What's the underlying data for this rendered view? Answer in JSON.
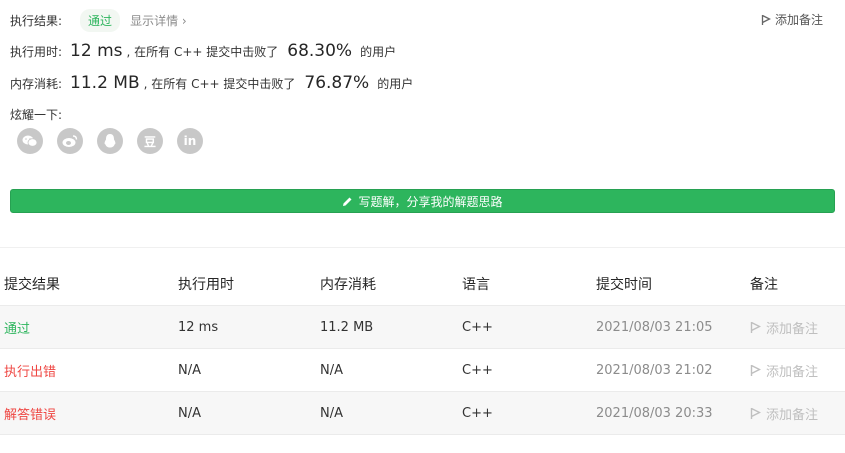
{
  "result": {
    "label": "执行结果:",
    "status": "通过",
    "details_link": "显示详情 ›",
    "add_note": "添加备注"
  },
  "runtime": {
    "label": "执行用时:",
    "value": "12 ms",
    "mid": ", 在所有 C++ 提交中击败了",
    "percent": "68.30%",
    "suffix": "的用户"
  },
  "memory": {
    "label": "内存消耗:",
    "value": "11.2 MB",
    "mid": ", 在所有 C++ 提交中击败了",
    "percent": "76.87%",
    "suffix": "的用户"
  },
  "share": {
    "label": "炫耀一下:",
    "icons": [
      "wechat-icon",
      "weibo-icon",
      "qq-icon",
      "douban-icon",
      "linkedin-icon"
    ],
    "douban_glyph": "豆",
    "linkedin_glyph": "in"
  },
  "write_solution_label": "写题解，分享我的解题思路",
  "table": {
    "headers": [
      "提交结果",
      "执行用时",
      "内存消耗",
      "语言",
      "提交时间",
      "备注"
    ],
    "rows": [
      {
        "status": "通过",
        "status_type": "pass",
        "runtime": "12 ms",
        "memory": "11.2 MB",
        "lang": "C++",
        "time": "2021/08/03 21:05",
        "note": "添加备注"
      },
      {
        "status": "执行出错",
        "status_type": "error",
        "runtime": "N/A",
        "memory": "N/A",
        "lang": "C++",
        "time": "2021/08/03 21:02",
        "note": "添加备注"
      },
      {
        "status": "解答错误",
        "status_type": "error",
        "runtime": "N/A",
        "memory": "N/A",
        "lang": "C++",
        "time": "2021/08/03 20:33",
        "note": "添加备注"
      }
    ]
  },
  "colors": {
    "accent_green": "#2db55d",
    "error_red": "#ef4743"
  }
}
